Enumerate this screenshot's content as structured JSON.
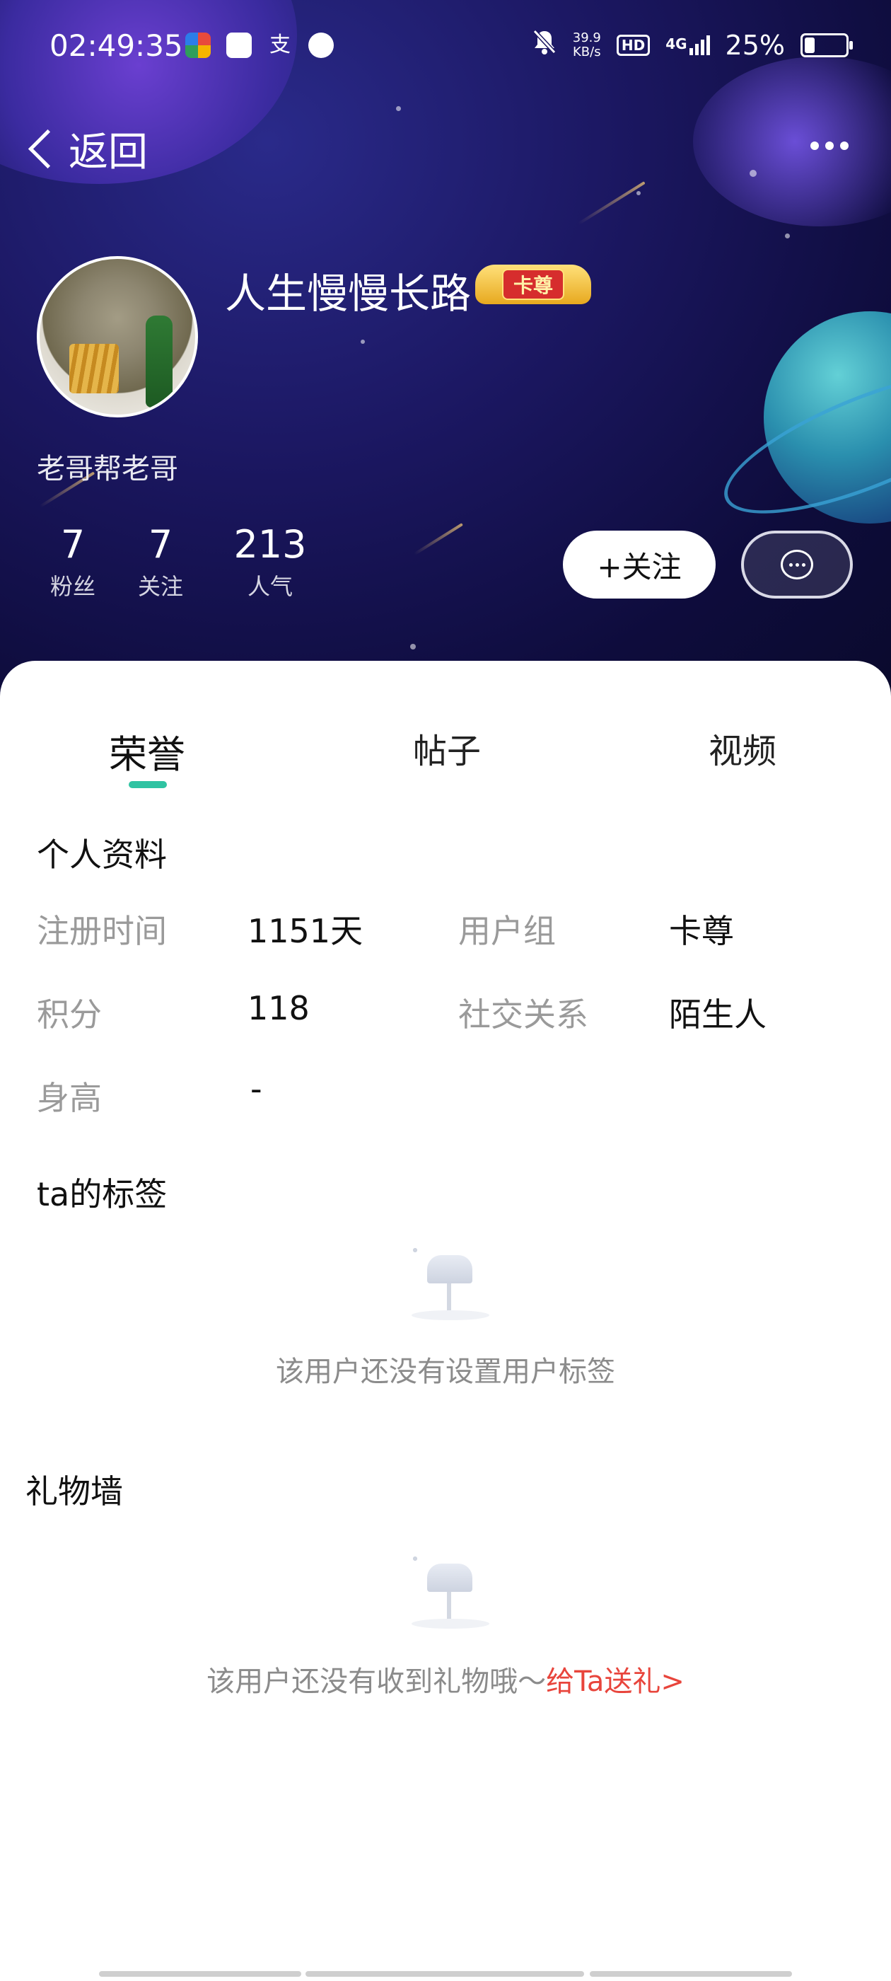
{
  "status_bar": {
    "time": "02:49:35",
    "net_speed_value": "39.9",
    "net_speed_unit": "KB/s",
    "hd": "HD",
    "signal": "4G",
    "battery": "25%",
    "battery_level": 0.25
  },
  "nav": {
    "back_label": "返回"
  },
  "profile": {
    "username": "人生慢慢长路",
    "badge": "卡尊",
    "signature": "老哥帮老哥",
    "stats": [
      {
        "value": "7",
        "label": "粉丝"
      },
      {
        "value": "7",
        "label": "关注"
      },
      {
        "value": "213",
        "label": "人气"
      }
    ],
    "follow_label": "+关注"
  },
  "tabs": [
    {
      "label": "荣誉",
      "active": true
    },
    {
      "label": "帖子",
      "active": false
    },
    {
      "label": "视频",
      "active": false
    }
  ],
  "personal_info": {
    "title": "个人资料",
    "fields": [
      {
        "label": "注册时间",
        "value": "1151天"
      },
      {
        "label": "用户组",
        "value": "卡尊"
      },
      {
        "label": "积分",
        "value": "118"
      },
      {
        "label": "社交关系",
        "value": "陌生人"
      },
      {
        "label": "身高",
        "value": "-"
      }
    ]
  },
  "tags": {
    "title": "ta的标签",
    "empty_text": "该用户还没有设置用户标签"
  },
  "gifts": {
    "title": "礼物墙",
    "empty_text": "该用户还没有收到礼物哦～",
    "gift_link": "给Ta送礼>"
  },
  "colors": {
    "accent": "#2fc3a2",
    "link": "#e8453c"
  }
}
